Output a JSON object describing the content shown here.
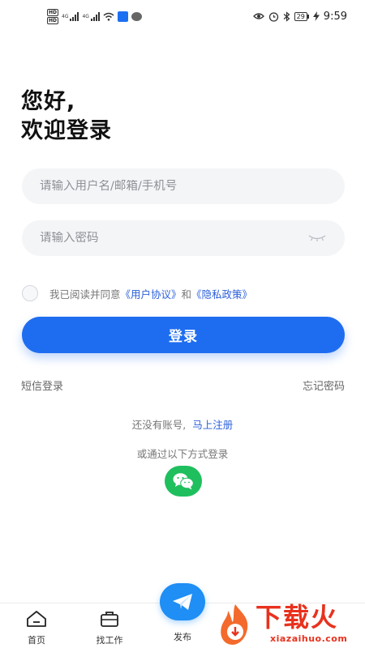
{
  "status_bar": {
    "hd_badge": "HD",
    "net_type": "4G",
    "time": "9:59",
    "battery_level": "29"
  },
  "greeting": {
    "line1": "您好,",
    "line2": "欢迎登录"
  },
  "form": {
    "username_placeholder": "请输入用户名/邮箱/手机号",
    "password_placeholder": "请输入密码"
  },
  "agreement": {
    "prefix": "我已阅读并同意",
    "user_agreement": "《用户协议》",
    "and": "和",
    "privacy_policy": "《隐私政策》"
  },
  "login_button": "登录",
  "links": {
    "sms_login": "短信登录",
    "forgot_password": "忘记密码"
  },
  "register": {
    "prompt": "还没有账号,",
    "action": "马上注册"
  },
  "other_login": "或通过以下方式登录",
  "bottom_nav": {
    "home": "首页",
    "find_job": "找工作",
    "publish": "发布"
  },
  "watermark": {
    "title": "下载火",
    "url": "xiazaihuo.com"
  },
  "colors": {
    "primary": "#1e6df1",
    "link": "#2b5fd9",
    "wechat": "#1fbf5e",
    "watermark": "#e8321e"
  }
}
